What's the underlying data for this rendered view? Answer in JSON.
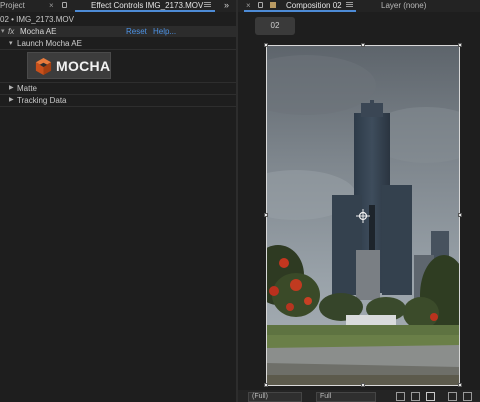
{
  "tabs": {
    "project_label": "Project",
    "effect_controls_label": "Effect Controls IMG_2173.MOV",
    "composition_label": "Composition 02",
    "layer_label": "Layer (none)",
    "overflow_chevron": "»"
  },
  "effect_controls": {
    "breadcrumb": "02 • IMG_2173.MOV",
    "fx_badge": "fx",
    "effect_name": "Mocha AE",
    "reset_label": "Reset",
    "help_label": "Help...",
    "launch_label": "Launch Mocha AE",
    "logo_text": "MOCHA",
    "sections": [
      {
        "label": "Matte"
      },
      {
        "label": "Tracking Data"
      }
    ]
  },
  "composition": {
    "tab_button_label": "02"
  },
  "viewer_bottom": {
    "resolution": "(Full)",
    "magnification": "Full"
  },
  "colors": {
    "accent": "#4d8bd6",
    "link": "#4d93e6",
    "panel_bg": "#1e1e1e",
    "mocha_orange": "#d3561e"
  }
}
